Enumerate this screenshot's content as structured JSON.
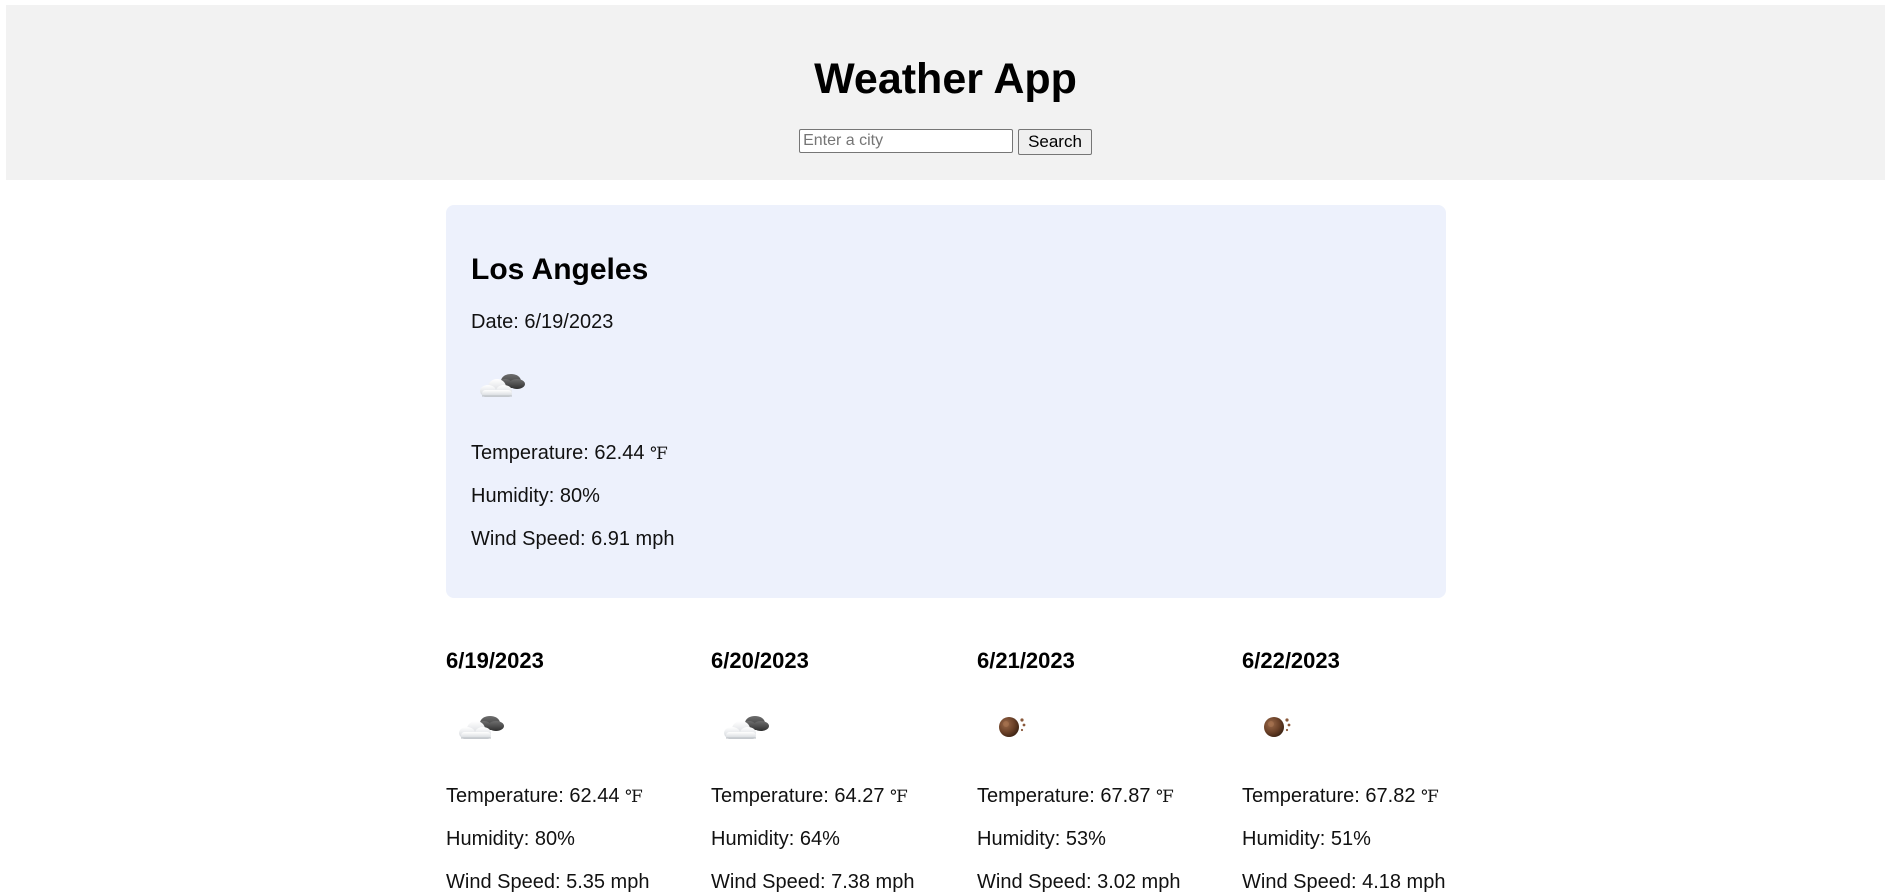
{
  "header": {
    "title": "Weather App",
    "search_placeholder": "Enter a city",
    "search_value": "",
    "search_button": "Search"
  },
  "current": {
    "city": "Los Angeles",
    "date_label": "Date:",
    "date": "6/19/2023",
    "icon": "partly-cloudy-icon",
    "temperature_label": "Temperature:",
    "temperature": "62.44",
    "temperature_unit": "℉",
    "humidity_label": "Humidity:",
    "humidity": "80%",
    "wind_label": "Wind Speed:",
    "wind": "6.91 mph"
  },
  "forecast": [
    {
      "date": "6/19/2023",
      "icon": "partly-cloudy-icon",
      "temperature_label": "Temperature:",
      "temperature": "62.44",
      "temperature_unit": "℉",
      "humidity_label": "Humidity:",
      "humidity": "80%",
      "wind_label": "Wind Speed:",
      "wind": "5.35 mph"
    },
    {
      "date": "6/20/2023",
      "icon": "partly-cloudy-icon",
      "temperature_label": "Temperature:",
      "temperature": "64.27",
      "temperature_unit": "℉",
      "humidity_label": "Humidity:",
      "humidity": "64%",
      "wind_label": "Wind Speed:",
      "wind": "7.38 mph"
    },
    {
      "date": "6/21/2023",
      "icon": "brown-orb-icon",
      "temperature_label": "Temperature:",
      "temperature": "67.87",
      "temperature_unit": "℉",
      "humidity_label": "Humidity:",
      "humidity": "53%",
      "wind_label": "Wind Speed:",
      "wind": "3.02 mph"
    },
    {
      "date": "6/22/2023",
      "icon": "brown-orb-icon",
      "temperature_label": "Temperature:",
      "temperature": "67.82",
      "temperature_unit": "℉",
      "humidity_label": "Humidity:",
      "humidity": "51%",
      "wind_label": "Wind Speed:",
      "wind": "4.18 mph"
    }
  ],
  "colors": {
    "header_bg": "#f2f2f2",
    "card_bg": "#edf1fc"
  }
}
